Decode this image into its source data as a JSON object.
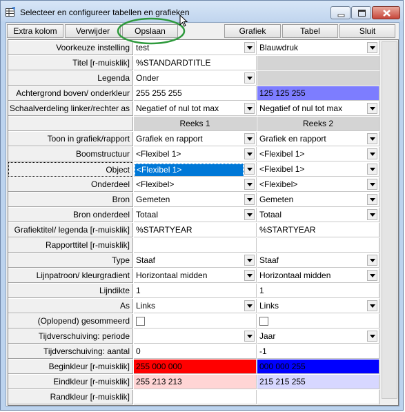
{
  "window": {
    "title": "Selecteer en configureer tabellen en grafieken"
  },
  "toolbar": {
    "extra_kolom": "Extra kolom",
    "verwijder": "Verwijder",
    "opslaan": "Opslaan",
    "grafiek": "Grafiek",
    "tabel": "Tabel",
    "sluit": "Sluit"
  },
  "colors": {
    "annotation_circle": "#2e9a3c",
    "selection": "#0078d7"
  },
  "rows": {
    "voorkeuze": {
      "label": "Voorkeuze instelling",
      "c1": "test",
      "c2": "Blauwdruk"
    },
    "titel": {
      "label": "Titel [r-muisklik]",
      "c1": "%STANDARDTITLE",
      "c2": ""
    },
    "legenda": {
      "label": "Legenda",
      "c1": "Onder",
      "c2": ""
    },
    "achtergrond": {
      "label": "Achtergrond boven/ onderkleur",
      "c1": "255 255 255",
      "c2": "125 125 255",
      "c1_bg": "#ffffff",
      "c2_bg": "#7d7dff"
    },
    "schaal": {
      "label": "Schaalverdeling linker/rechter as",
      "c1": "Negatief of nul tot max",
      "c2": "Negatief of nul tot max"
    },
    "reeks": {
      "label": "",
      "c1": "Reeks 1",
      "c2": "Reeks 2"
    },
    "toon": {
      "label": "Toon in grafiek/rapport",
      "c1": "Grafiek en rapport",
      "c2": "Grafiek en rapport"
    },
    "boom": {
      "label": "Boomstructuur",
      "c1": "<Flexibel 1>",
      "c2": "<Flexibel 1>"
    },
    "object": {
      "label": "Object",
      "c1": "<Flexibel 1>",
      "c2": "<Flexibel 1>"
    },
    "onderdeel": {
      "label": "Onderdeel",
      "c1": "<Flexibel>",
      "c2": "<Flexibel>"
    },
    "bron": {
      "label": "Bron",
      "c1": "Gemeten",
      "c2": "Gemeten"
    },
    "bron_onderdeel": {
      "label": "Bron onderdeel",
      "c1": "Totaal",
      "c2": "Totaal"
    },
    "grafiektitel": {
      "label": "Grafiektitel/ legenda [r-muisklik]",
      "c1": "%STARTYEAR",
      "c2": "%STARTYEAR"
    },
    "rapporttitel": {
      "label": "Rapporttitel [r-muisklik]",
      "c1": "",
      "c2": ""
    },
    "type": {
      "label": "Type",
      "c1": "Staaf",
      "c2": "Staaf"
    },
    "lijnpatroon": {
      "label": "Lijnpatroon/ kleurgradient",
      "c1": "Horizontaal midden",
      "c2": "Horizontaal midden"
    },
    "lijndikte": {
      "label": "Lijndikte",
      "c1": "1",
      "c2": "1"
    },
    "as": {
      "label": "As",
      "c1": "Links",
      "c2": "Links"
    },
    "oplopend": {
      "label": "(Oplopend) gesommeerd",
      "c1": "",
      "c2": ""
    },
    "tijd_periode": {
      "label": "Tijdverschuiving: periode",
      "c1": "",
      "c2": "Jaar"
    },
    "tijd_aantal": {
      "label": "Tijdverschuiving: aantal",
      "c1": "0",
      "c2": "-1"
    },
    "beginkleur": {
      "label": "Beginkleur [r-muisklik]",
      "c1": "255 000 000",
      "c2": "000 000 255",
      "c1_bg": "#ff0000",
      "c2_bg": "#0000ff"
    },
    "eindkleur": {
      "label": "Eindkleur [r-muisklik]",
      "c1": "255 213 213",
      "c2": "215 215 255",
      "c1_bg": "#ffd5d5",
      "c2_bg": "#d7d7ff"
    },
    "randkleur": {
      "label": "Randkleur [r-muisklik]",
      "c1": "",
      "c2": ""
    }
  }
}
